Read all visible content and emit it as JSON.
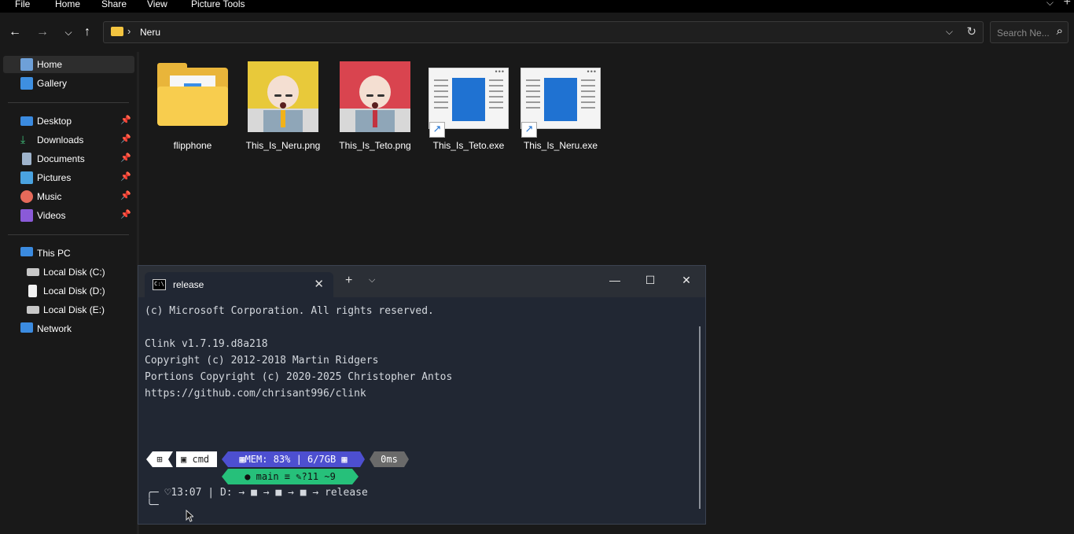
{
  "ribbon": {
    "menus": [
      "File",
      "Home",
      "Share",
      "View",
      "Picture Tools"
    ]
  },
  "address": {
    "crumb": "Neru",
    "search_placeholder": "Search Ne..."
  },
  "sidebar": {
    "quick": [
      {
        "label": "Home",
        "icon": "home-icon",
        "selected": true
      },
      {
        "label": "Gallery",
        "icon": "gallery-icon"
      }
    ],
    "pinned": [
      {
        "label": "Desktop",
        "icon": "desktop-icon"
      },
      {
        "label": "Downloads",
        "icon": "downloads-icon"
      },
      {
        "label": "Documents",
        "icon": "documents-icon"
      },
      {
        "label": "Pictures",
        "icon": "pictures-icon"
      },
      {
        "label": "Music",
        "icon": "music-icon"
      },
      {
        "label": "Videos",
        "icon": "videos-icon"
      }
    ],
    "this_pc": "This PC",
    "drives": [
      "Local Disk (C:)",
      "Local Disk (D:)",
      "Local Disk (E:)"
    ],
    "network": "Network"
  },
  "files": [
    {
      "name": "flipphone",
      "type": "folder"
    },
    {
      "name": "This_Is_Neru.png",
      "type": "image",
      "hair_color": "#e8c93a",
      "tie_color": "#f2b21a"
    },
    {
      "name": "This_Is_Teto.png",
      "type": "image",
      "hair_color": "#d9444f",
      "tie_color": "#c23340"
    },
    {
      "name": "This_Is_Teto.exe",
      "type": "shortcut"
    },
    {
      "name": "This_Is_Neru.exe",
      "type": "shortcut"
    }
  ],
  "terminal": {
    "tab_title": "release",
    "lines": [
      "(c) Microsoft Corporation. All rights reserved.",
      "",
      "Clink v1.7.19.d8a218",
      "Copyright (c) 2012-2018 Martin Ridgers",
      "Portions Copyright (c) 2020-2025 Christopher Antos",
      "https://github.com/chrisant996/clink"
    ],
    "prompt": {
      "shell": "cmd",
      "mem": "MEM: 83% | 6/7GB",
      "duration": "0ms",
      "git": "main ≡ ✎?11 ~9",
      "clock": "13:07",
      "path_drive": "D:",
      "path_end": "release"
    }
  },
  "colors": {
    "background": "#191919",
    "terminal_bg": "#212733",
    "mem_segment": "#4d4fd0",
    "git_segment": "#26c07a"
  }
}
